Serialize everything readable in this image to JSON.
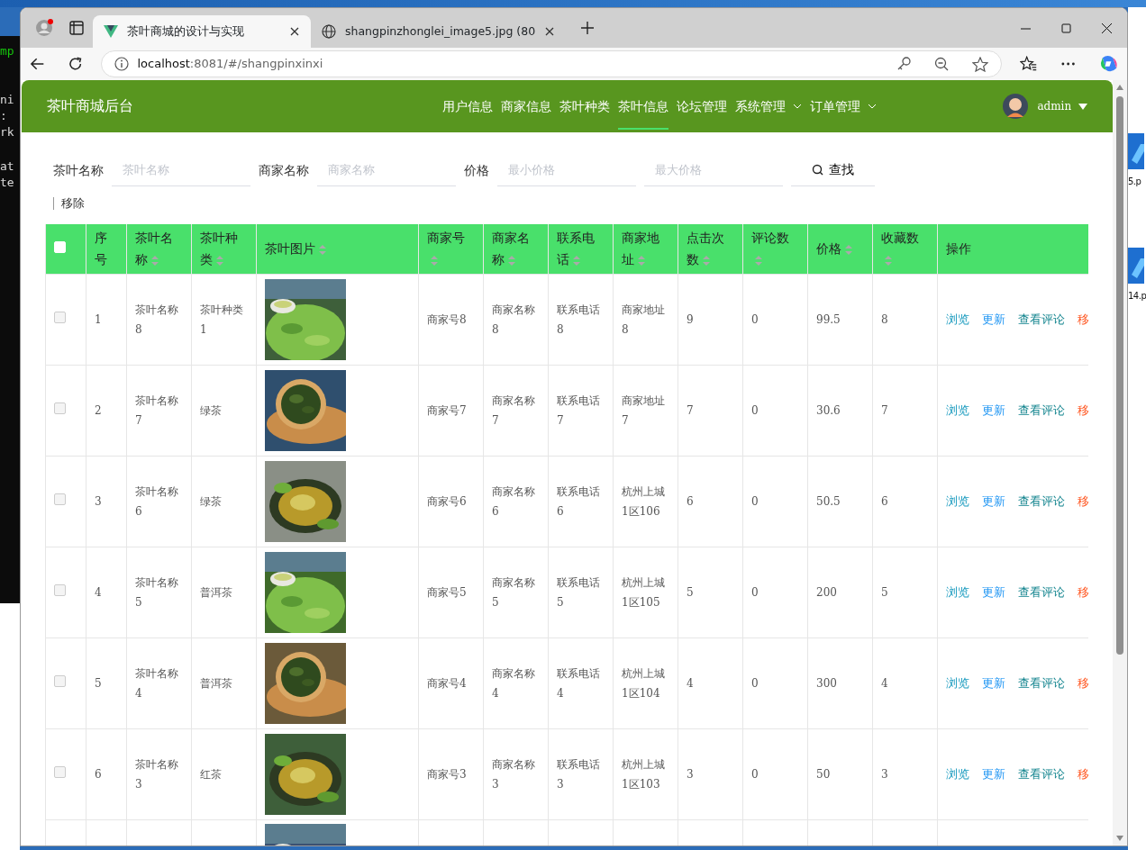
{
  "desktop": {
    "terminal_lines": [
      {
        "text": "mp",
        "kind": "prompt"
      },
      {
        "text": "ni",
        "kind": "output"
      },
      {
        "text": ":",
        "kind": "output"
      },
      {
        "text": "rk",
        "kind": "output"
      },
      {
        "text": "at",
        "kind": "output"
      },
      {
        "text": "te",
        "kind": "output"
      }
    ],
    "files": [
      {
        "label": "5.p"
      },
      {
        "label": "14.p"
      }
    ]
  },
  "browser": {
    "tabs": [
      {
        "title": "茶叶商城的设计与实现",
        "selected": true,
        "kind": "vue"
      },
      {
        "title": "shangpinzhonglei_image5.jpg (80",
        "selected": false,
        "kind": "globe"
      }
    ],
    "address": {
      "host": "localhost",
      "path": ":8081/#/shangpinxinxi"
    }
  },
  "navbar": {
    "title": "茶叶商城后台",
    "items": [
      {
        "label": "用户信息",
        "selected": false,
        "dropdown": false
      },
      {
        "label": "商家信息",
        "selected": false,
        "dropdown": false
      },
      {
        "label": "茶叶种类",
        "selected": false,
        "dropdown": false
      },
      {
        "label": "茶叶信息",
        "selected": true,
        "dropdown": false
      },
      {
        "label": "论坛管理",
        "selected": false,
        "dropdown": false
      },
      {
        "label": "系统管理",
        "selected": false,
        "dropdown": true
      },
      {
        "label": "订单管理",
        "selected": false,
        "dropdown": true
      }
    ],
    "user": "admin"
  },
  "search": {
    "fields": [
      {
        "label": "茶叶名称",
        "placeholder": "茶叶名称"
      },
      {
        "label": "商家名称",
        "placeholder": "商家名称"
      },
      {
        "label": "价格",
        "placeholder": "最小价格"
      },
      {
        "placeholder": "最大价格"
      }
    ],
    "button": "查找"
  },
  "remove_button": "移除",
  "table": {
    "all_checked": false,
    "columns": [
      {
        "label": "序号",
        "sortable": false
      },
      {
        "label": "茶叶名称",
        "sortable": true
      },
      {
        "label": "茶叶种类",
        "sortable": true
      },
      {
        "label": "茶叶图片",
        "sortable": true
      },
      {
        "label": "商家号",
        "sortable": true
      },
      {
        "label": "商家名称",
        "sortable": true
      },
      {
        "label": "联系电话",
        "sortable": true
      },
      {
        "label": "商家地址",
        "sortable": true
      },
      {
        "label": "点击次数",
        "sortable": true
      },
      {
        "label": "评论数",
        "sortable": true
      },
      {
        "label": "价格",
        "sortable": true
      },
      {
        "label": "收藏数",
        "sortable": true
      },
      {
        "label": "操作",
        "sortable": false
      }
    ],
    "rows": [
      {
        "kind": "full",
        "checked": false,
        "cells": [
          "1",
          "茶叶名称8",
          "茶叶种类1",
          "商家号8",
          "商家名称8",
          "联系电话8",
          "商家地址8",
          "9",
          "0",
          "99.5",
          "8"
        ],
        "actions": [
          {
            "label": "浏览",
            "kind": "view"
          },
          {
            "label": "更新",
            "kind": "update"
          },
          {
            "label": "查看评论",
            "kind": "comments"
          },
          {
            "label": "移",
            "kind": "remove"
          }
        ]
      },
      {
        "kind": "full",
        "checked": false,
        "cells": [
          "2",
          "茶叶名称7",
          "绿茶",
          "商家号7",
          "商家名称7",
          "联系电话7",
          "商家地址7",
          "7",
          "0",
          "30.6",
          "7"
        ],
        "actions": [
          {
            "label": "浏览",
            "kind": "view"
          },
          {
            "label": "更新",
            "kind": "update"
          },
          {
            "label": "查看评论",
            "kind": "comments"
          },
          {
            "label": "移",
            "kind": "remove"
          }
        ]
      },
      {
        "kind": "full",
        "checked": false,
        "cells": [
          "3",
          "茶叶名称6",
          "绿茶",
          "商家号6",
          "商家名称6",
          "联系电话6",
          "杭州上城1区106",
          "6",
          "0",
          "50.5",
          "6"
        ],
        "actions": [
          {
            "label": "浏览",
            "kind": "view"
          },
          {
            "label": "更新",
            "kind": "update"
          },
          {
            "label": "查看评论",
            "kind": "comments"
          },
          {
            "label": "移",
            "kind": "remove"
          }
        ]
      },
      {
        "kind": "full",
        "checked": false,
        "cells": [
          "4",
          "茶叶名称5",
          "普洱茶",
          "商家号5",
          "商家名称5",
          "联系电话5",
          "杭州上城1区105",
          "5",
          "0",
          "200",
          "5"
        ],
        "actions": [
          {
            "label": "浏览",
            "kind": "view"
          },
          {
            "label": "更新",
            "kind": "update"
          },
          {
            "label": "查看评论",
            "kind": "comments"
          },
          {
            "label": "移",
            "kind": "remove"
          }
        ]
      },
      {
        "kind": "full",
        "checked": false,
        "cells": [
          "5",
          "茶叶名称4",
          "普洱茶",
          "商家号4",
          "商家名称4",
          "联系电话4",
          "杭州上城1区104",
          "4",
          "0",
          "300",
          "4"
        ],
        "actions": [
          {
            "label": "浏览",
            "kind": "view"
          },
          {
            "label": "更新",
            "kind": "update"
          },
          {
            "label": "查看评论",
            "kind": "comments"
          },
          {
            "label": "移",
            "kind": "remove"
          }
        ]
      },
      {
        "kind": "full",
        "checked": false,
        "cells": [
          "6",
          "茶叶名称3",
          "红茶",
          "商家号3",
          "商家名称3",
          "联系电话3",
          "杭州上城1区103",
          "3",
          "0",
          "50",
          "3"
        ],
        "actions": [
          {
            "label": "浏览",
            "kind": "view"
          },
          {
            "label": "更新",
            "kind": "update"
          },
          {
            "label": "查看评论",
            "kind": "comments"
          },
          {
            "label": "移",
            "kind": "remove"
          }
        ]
      },
      {
        "kind": "cut"
      }
    ]
  }
}
